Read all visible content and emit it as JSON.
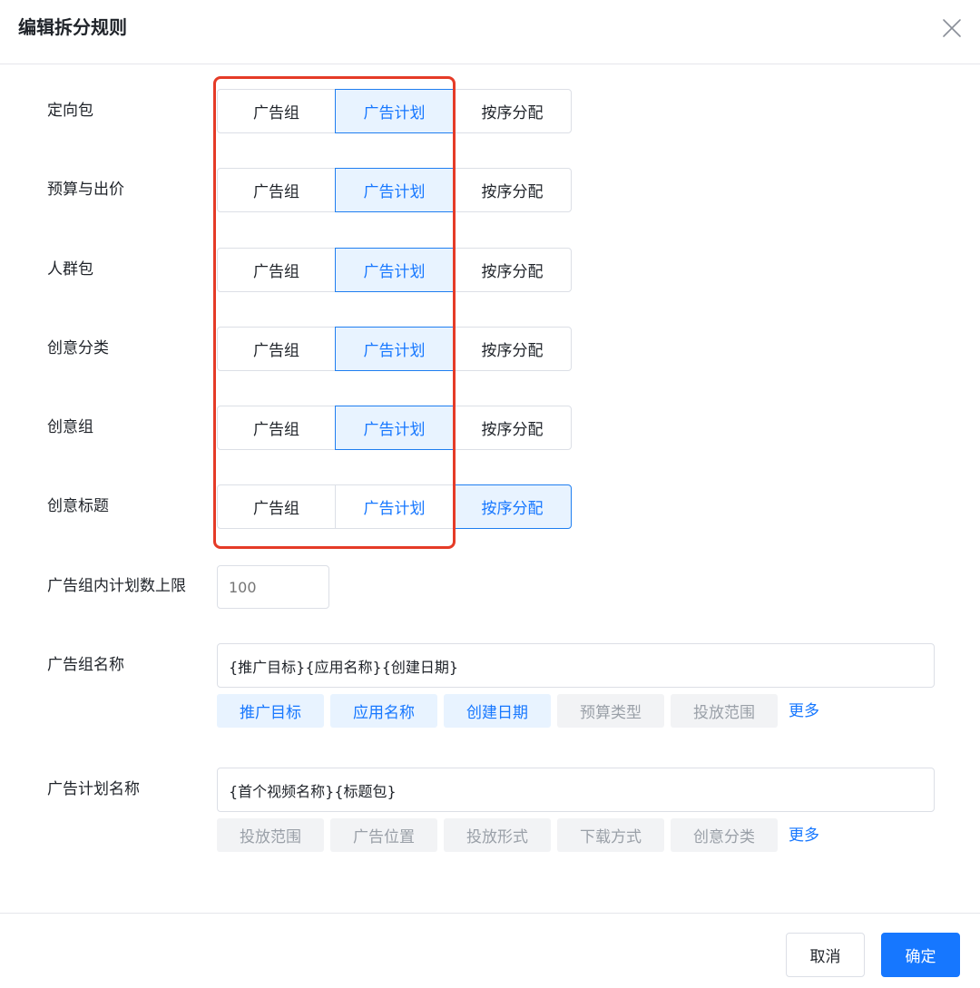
{
  "dialog": {
    "title": "编辑拆分规则"
  },
  "split_rules": [
    {
      "label": "定向包",
      "options": [
        "广告组",
        "广告计划",
        "按序分配"
      ],
      "selected": "广告计划"
    },
    {
      "label": "预算与出价",
      "options": [
        "广告组",
        "广告计划",
        "按序分配"
      ],
      "selected": "广告计划"
    },
    {
      "label": "人群包",
      "options": [
        "广告组",
        "广告计划",
        "按序分配"
      ],
      "selected": "广告计划"
    },
    {
      "label": "创意分类",
      "options": [
        "广告组",
        "广告计划",
        "按序分配"
      ],
      "selected": "广告计划"
    },
    {
      "label": "创意组",
      "options": [
        "广告组",
        "广告计划",
        "按序分配"
      ],
      "selected": "广告计划"
    },
    {
      "label": "创意标题",
      "options": [
        "广告组",
        "广告计划",
        "按序分配"
      ],
      "selected": "按序分配"
    }
  ],
  "plan_limit": {
    "label": "广告组内计划数上限",
    "placeholder": "100"
  },
  "group_name": {
    "label": "广告组名称",
    "value": "{推广目标}{应用名称}{创建日期}",
    "tags": [
      {
        "text": "推广目标",
        "active": true
      },
      {
        "text": "应用名称",
        "active": true
      },
      {
        "text": "创建日期",
        "active": true
      },
      {
        "text": "预算类型",
        "active": false
      },
      {
        "text": "投放范围",
        "active": false
      }
    ],
    "more": "更多"
  },
  "plan_name": {
    "label": "广告计划名称",
    "value": "{首个视频名称}{标题包}",
    "tags": [
      {
        "text": "投放范围",
        "active": false
      },
      {
        "text": "广告位置",
        "active": false
      },
      {
        "text": "投放形式",
        "active": false
      },
      {
        "text": "下载方式",
        "active": false
      },
      {
        "text": "创意分类",
        "active": false
      }
    ],
    "more": "更多"
  },
  "footer": {
    "cancel": "取消",
    "confirm": "确定"
  },
  "colors": {
    "primary": "#1677ff",
    "active_bg": "#e8f3ff",
    "highlight_border": "#e53b27"
  },
  "icons": {
    "close": "close-icon"
  }
}
